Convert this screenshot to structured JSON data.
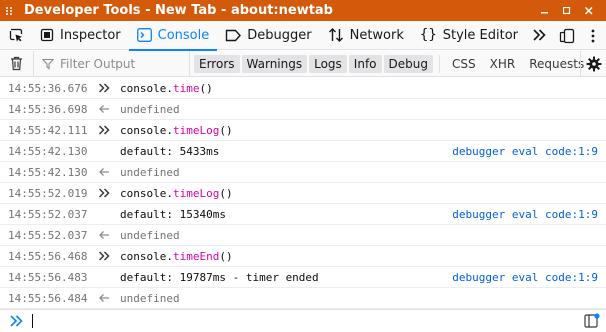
{
  "window": {
    "title": "Developer Tools - New Tab - about:newtab"
  },
  "tabs": [
    {
      "label": "Inspector",
      "icon": "inspector-icon"
    },
    {
      "label": "Console",
      "icon": "console-icon",
      "selected": true
    },
    {
      "label": "Debugger",
      "icon": "debugger-icon"
    },
    {
      "label": "Network",
      "icon": "network-icon"
    },
    {
      "label": "Style Editor",
      "icon": "style-editor-icon"
    }
  ],
  "filter": {
    "placeholder": "Filter Output"
  },
  "levels": [
    "Errors",
    "Warnings",
    "Logs",
    "Info",
    "Debug"
  ],
  "categories": [
    "CSS",
    "XHR",
    "Requests"
  ],
  "rows": [
    {
      "time": "14:55:36.676",
      "kind": "command",
      "obj": "console",
      "fn": "time",
      "args": "()"
    },
    {
      "time": "14:55:36.698",
      "kind": "result",
      "text": "undefined"
    },
    {
      "time": "14:55:42.111",
      "kind": "command",
      "obj": "console",
      "fn": "timeLog",
      "args": "()"
    },
    {
      "time": "14:55:42.130",
      "kind": "log",
      "text": "default: 5433ms",
      "location": "debugger eval code:1:9"
    },
    {
      "time": "14:55:42.130",
      "kind": "result",
      "text": "undefined"
    },
    {
      "time": "14:55:52.019",
      "kind": "command",
      "obj": "console",
      "fn": "timeLog",
      "args": "()"
    },
    {
      "time": "14:55:52.037",
      "kind": "log",
      "text": "default: 15340ms",
      "location": "debugger eval code:1:9"
    },
    {
      "time": "14:55:52.037",
      "kind": "result",
      "text": "undefined"
    },
    {
      "time": "14:55:56.468",
      "kind": "command",
      "obj": "console",
      "fn": "timeEnd",
      "args": "()"
    },
    {
      "time": "14:55:56.483",
      "kind": "log",
      "text": "default: 19787ms - timer ended",
      "location": "debugger eval code:1:9"
    },
    {
      "time": "14:55:56.484",
      "kind": "result",
      "text": "undefined"
    }
  ],
  "colors": {
    "titlebar": "#d3590b",
    "accent": "#0a84ff",
    "location": "#0060df"
  }
}
